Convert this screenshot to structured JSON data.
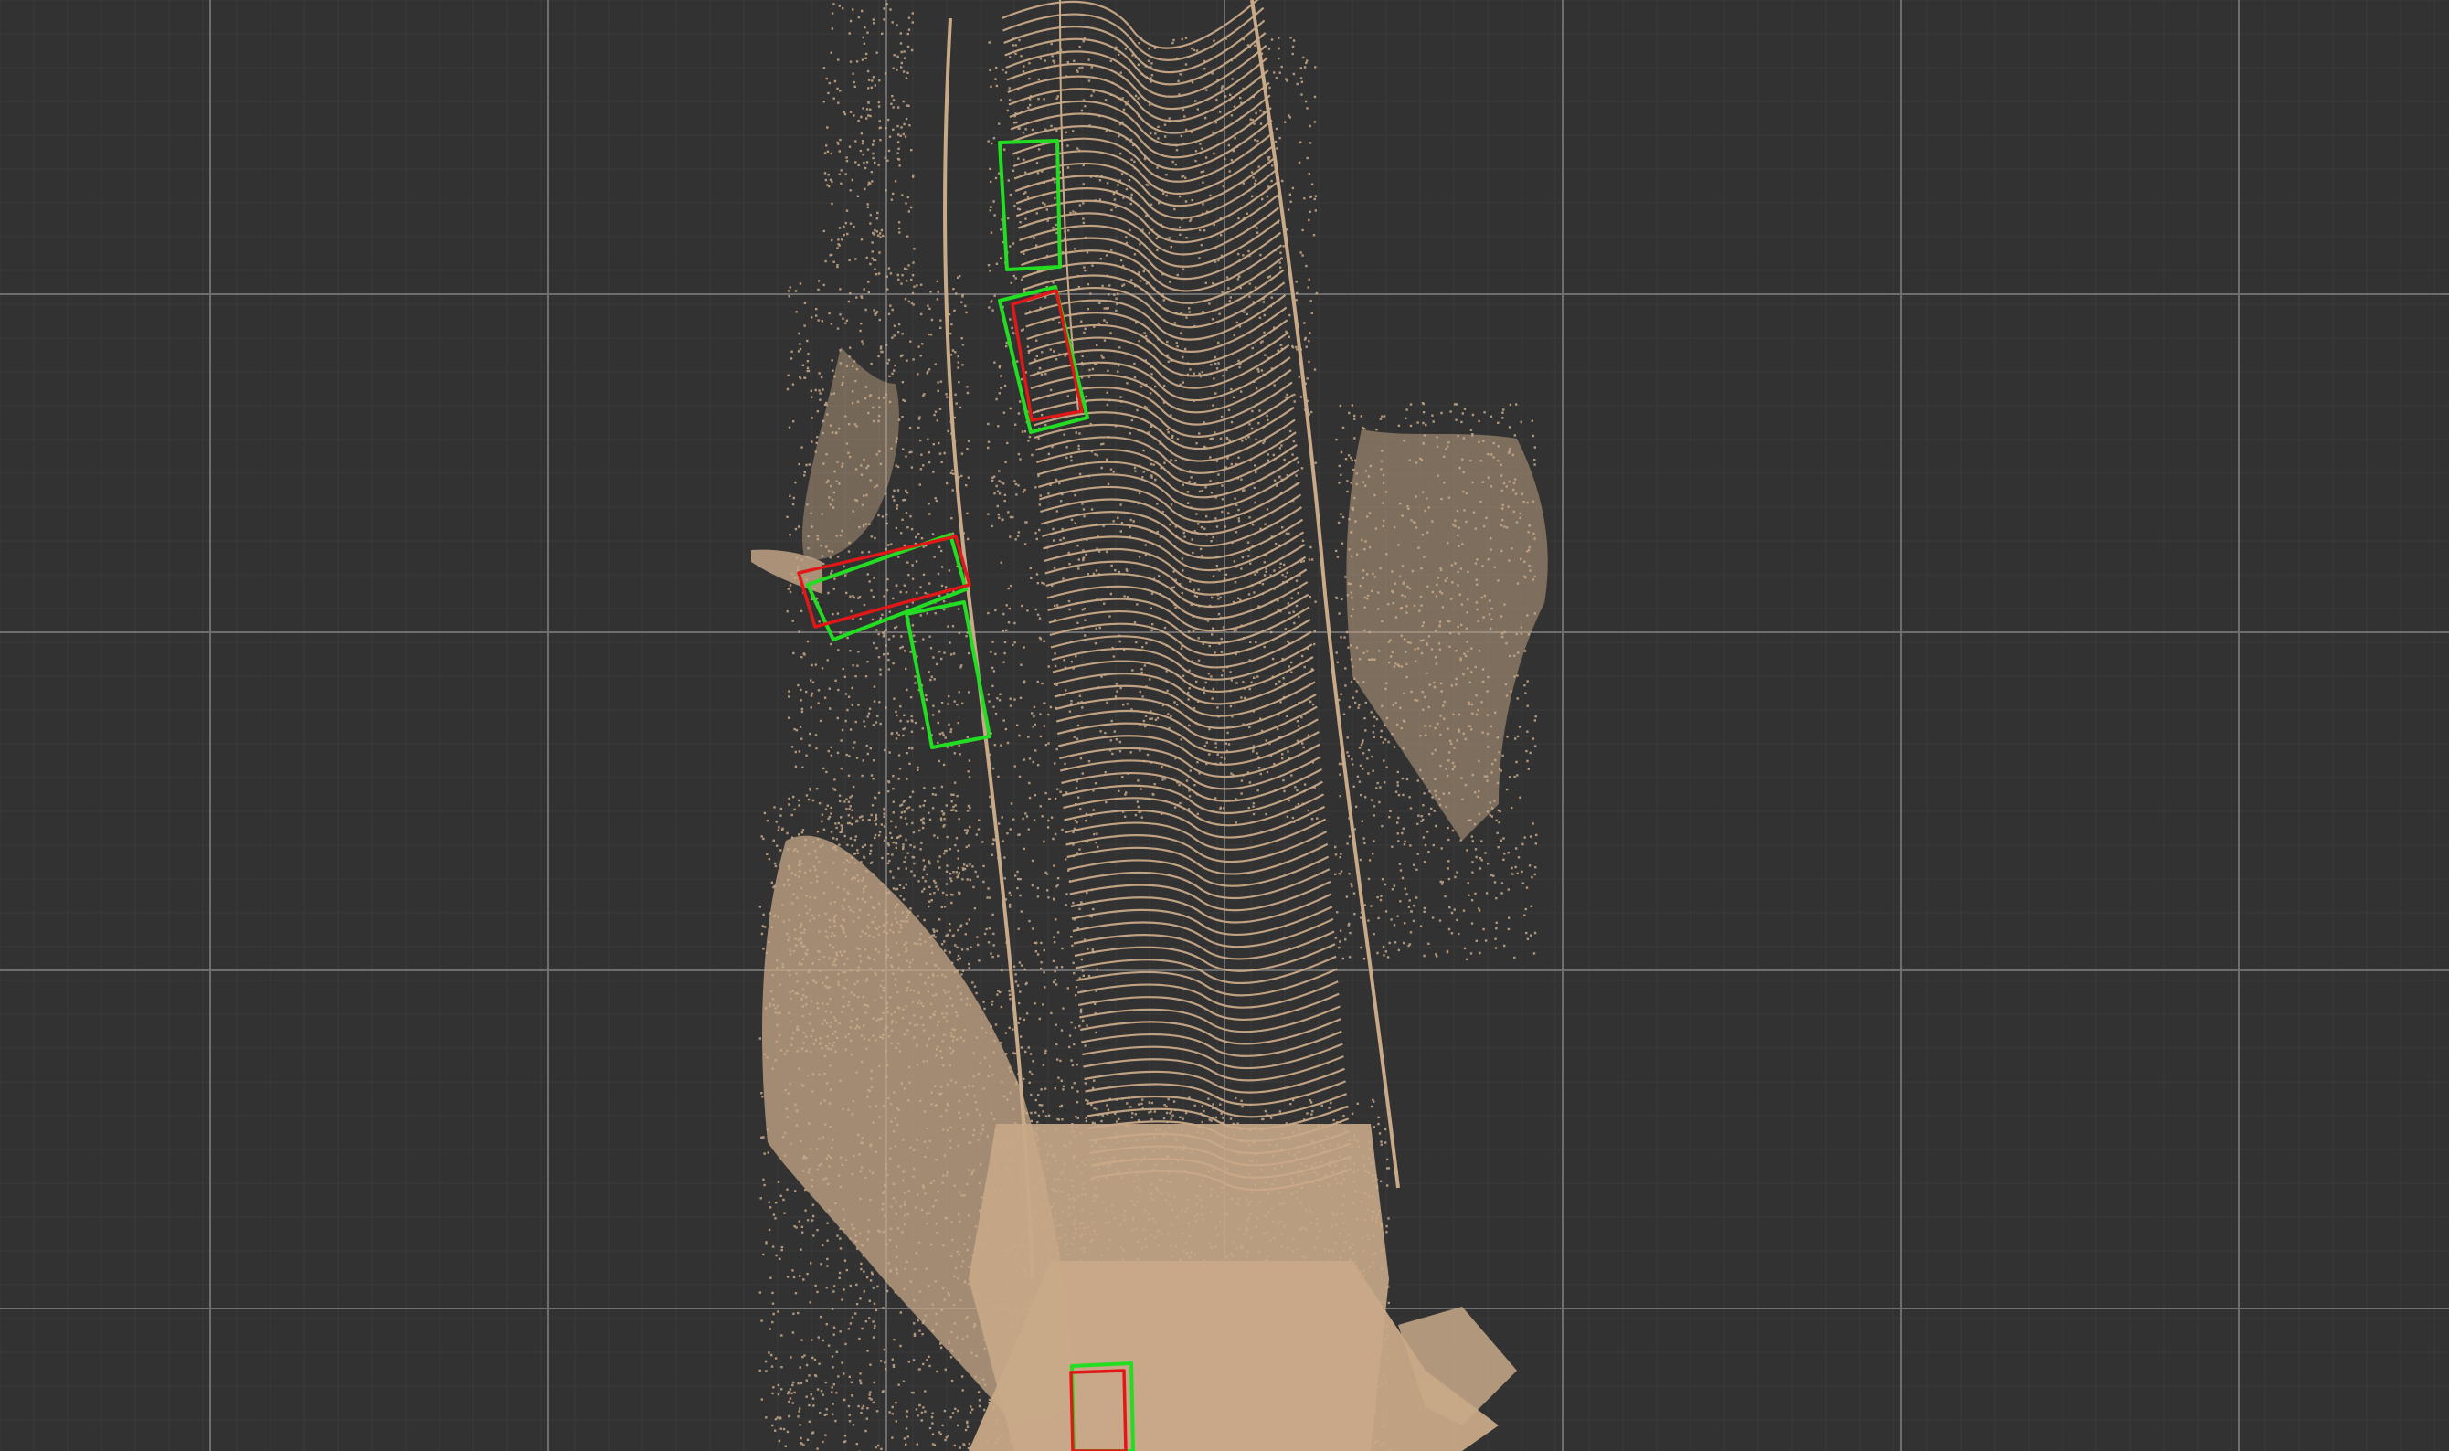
{
  "viewer": {
    "background_color": "#323232",
    "minor_grid_color": "#3b3b3b",
    "major_grid_color": "#6e6e6e",
    "point_color": "#c8a988",
    "ground_truth_box_color": "#22dd22",
    "prediction_box_color": "#e01818",
    "view": "bird's-eye view"
  },
  "detections": {
    "ground_truth": [
      {
        "id": "gt-1",
        "label": "",
        "shape": "rotated-rectangle"
      },
      {
        "id": "gt-2",
        "label": "",
        "shape": "rotated-rectangle"
      },
      {
        "id": "gt-3",
        "label": "",
        "shape": "rotated-rectangle"
      },
      {
        "id": "gt-4",
        "label": "",
        "shape": "rotated-rectangle"
      },
      {
        "id": "gt-5",
        "label": "",
        "shape": "rotated-rectangle"
      }
    ],
    "predictions": [
      {
        "id": "pred-1",
        "label": "",
        "shape": "rotated-rectangle"
      },
      {
        "id": "pred-2",
        "label": "",
        "shape": "rotated-rectangle"
      },
      {
        "id": "pred-3",
        "label": "",
        "shape": "rotated-rectangle"
      }
    ]
  }
}
